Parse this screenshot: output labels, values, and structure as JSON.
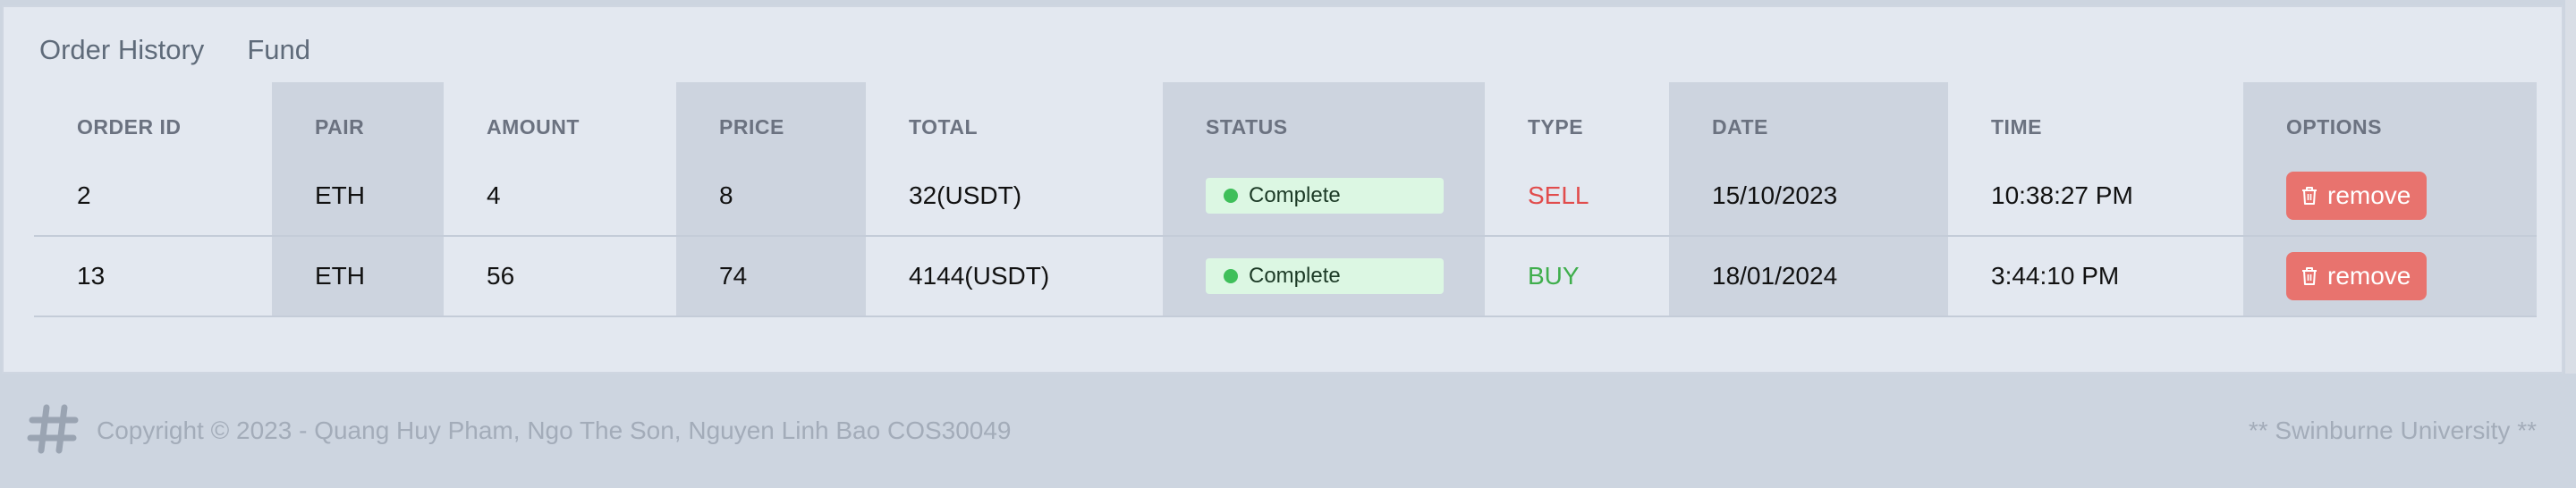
{
  "tabs": [
    {
      "label": "Order History"
    },
    {
      "label": "Fund"
    }
  ],
  "table": {
    "headers": [
      "ORDER ID",
      "PAIR",
      "AMOUNT",
      "PRICE",
      "TOTAL",
      "STATUS",
      "TYPE",
      "DATE",
      "TIME",
      "OPTIONS"
    ],
    "rows": [
      {
        "order_id": "2",
        "pair": "ETH",
        "amount": "4",
        "price": "8",
        "total": "32(USDT)",
        "status": "Complete",
        "type": "SELL",
        "date": "15/10/2023",
        "time": "10:38:27 PM",
        "option_label": "remove"
      },
      {
        "order_id": "13",
        "pair": "ETH",
        "amount": "56",
        "price": "74",
        "total": "4144(USDT)",
        "status": "Complete",
        "type": "BUY",
        "date": "18/01/2024",
        "time": "3:44:10 PM",
        "option_label": "remove"
      }
    ]
  },
  "footer": {
    "copyright": "Copyright © 2023 - Quang Huy Pham, Ngo The Son, Nguyen Linh Bao COS30049",
    "right_text": "** Swinburne University **",
    "logo_icon": "hashtag-icon"
  },
  "icons": {
    "remove": "trash-icon",
    "status": "status-dot-icon"
  },
  "colors": {
    "sell": "#e14c4c",
    "buy": "#3fae4c",
    "remove_button": "#e8736e",
    "status_badge_bg": "#dcf7e3",
    "status_dot": "#3fbf5a"
  }
}
